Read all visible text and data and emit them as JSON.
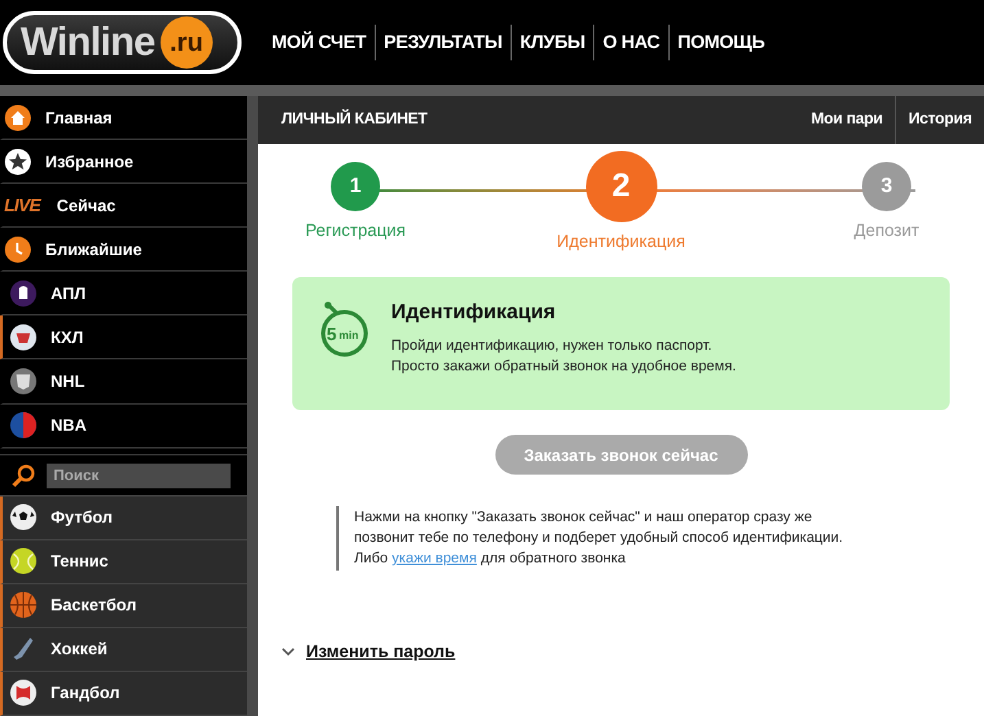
{
  "logo": {
    "name": "Winline",
    "domain": ".ru"
  },
  "nav": [
    "МОЙ СЧЕТ",
    "РЕЗУЛЬТАТЫ",
    "КЛУБЫ",
    "О НАС",
    "ПОМОЩЬ"
  ],
  "sidebar": {
    "items": [
      {
        "label": "Главная",
        "kind": "top",
        "marked": false
      },
      {
        "label": "Избранное",
        "kind": "top",
        "marked": false
      },
      {
        "label": "Сейчас",
        "badge": "LIVE",
        "kind": "top",
        "marked": false
      },
      {
        "label": "Ближайшие",
        "kind": "top",
        "marked": false
      },
      {
        "label": "АПЛ",
        "kind": "top",
        "marked": false
      },
      {
        "label": "КХЛ",
        "kind": "top",
        "marked": true
      },
      {
        "label": "NHL",
        "kind": "top",
        "marked": false
      },
      {
        "label": "NBA",
        "kind": "top",
        "marked": false
      }
    ],
    "search": {
      "placeholder": "Поиск"
    },
    "sports": [
      {
        "label": "Футбол",
        "kind": "sport",
        "marked": true
      },
      {
        "label": "Теннис",
        "kind": "sport",
        "marked": true
      },
      {
        "label": "Баскетбол",
        "kind": "sport",
        "marked": true
      },
      {
        "label": "Хоккей",
        "kind": "sport",
        "marked": true
      },
      {
        "label": "Гандбол",
        "kind": "sport",
        "marked": true
      }
    ]
  },
  "cabinet": {
    "title": "ЛИЧНЫЙ КАБИНЕТ",
    "tabs": [
      "Мои пари",
      "История"
    ]
  },
  "steps": [
    {
      "number": "1",
      "label": "Регистрация",
      "kind": "done"
    },
    {
      "number": "2",
      "label": "Идентификация",
      "kind": "current"
    },
    {
      "number": "3",
      "label": "Депозит",
      "kind": "pending"
    }
  ],
  "card": {
    "badge": "5",
    "unit": "min",
    "title": "Идентификация",
    "lines": [
      "Пройди идентификацию, нужен только паспорт.",
      "Просто закажи обратный звонок на удобное время."
    ]
  },
  "call_button": {
    "label": "Заказать звонок сейчас",
    "disabled": true
  },
  "info": {
    "text": "Нажми на кнопку \"Заказать звонок сейчас\" и наш оператор сразу же позвонит тебе по телефону и подберет удобный способ идентификации.",
    "before_link": "Либо",
    "link": "укажи время",
    "after_link": "для обратного звонка"
  },
  "password": {
    "label": "Изменить пароль",
    "expanded": false
  }
}
